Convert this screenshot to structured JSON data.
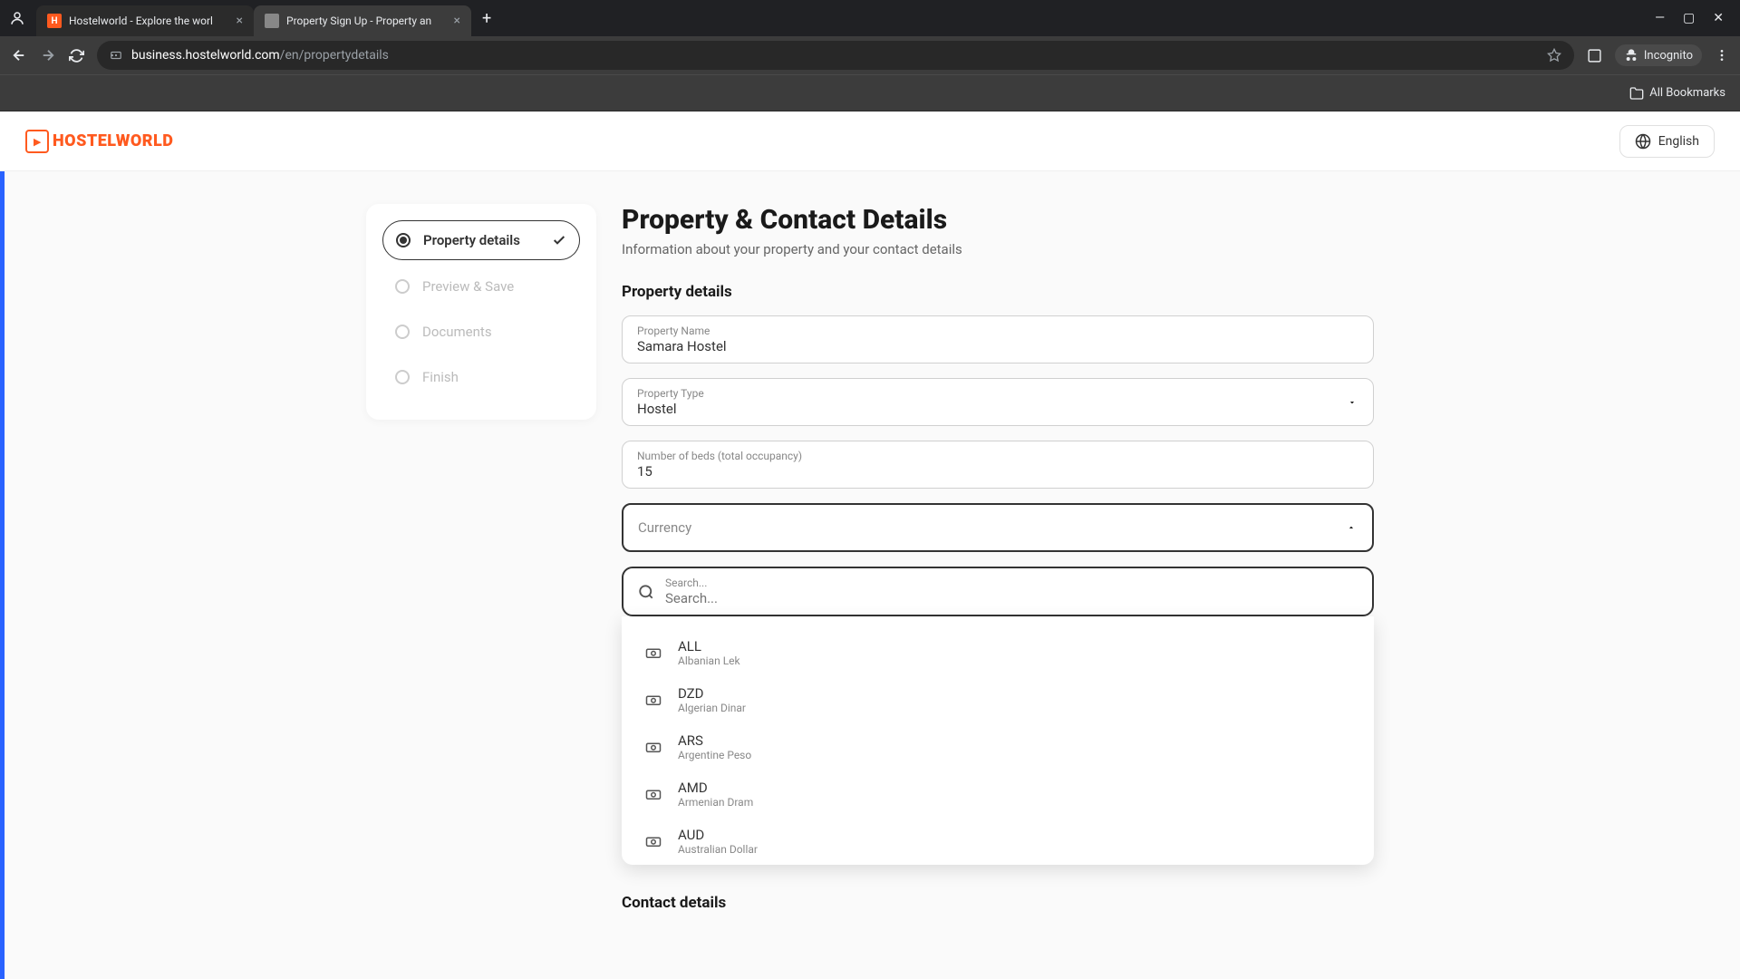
{
  "browser": {
    "tabs": [
      {
        "title": "Hostelworld - Explore the worl",
        "favicon": "H",
        "active": false
      },
      {
        "title": "Property Sign Up - Property an",
        "favicon": "",
        "active": true
      }
    ],
    "url_domain": "business.hostelworld.com",
    "url_path": "/en/propertydetails",
    "incognito_label": "Incognito",
    "bookmarks_label": "All Bookmarks"
  },
  "header": {
    "logo_text": "HOSTELWORLD",
    "language": "English"
  },
  "sidebar": {
    "steps": [
      {
        "label": "Property details",
        "active": true,
        "done": true
      },
      {
        "label": "Preview & Save",
        "active": false,
        "done": false
      },
      {
        "label": "Documents",
        "active": false,
        "done": false
      },
      {
        "label": "Finish",
        "active": false,
        "done": false
      }
    ]
  },
  "main": {
    "title": "Property & Contact Details",
    "subtitle": "Information about your property and your contact details",
    "section_property": "Property details",
    "section_contact": "Contact details",
    "fields": {
      "property_name_label": "Property Name",
      "property_name_value": "Samara Hostel",
      "property_type_label": "Property Type",
      "property_type_value": "Hostel",
      "beds_label": "Number of beds (total occupancy)",
      "beds_value": "15",
      "currency_label": "Currency"
    },
    "search_placeholder": "Search...",
    "currency_options": [
      {
        "code": "ALL",
        "name": "Albanian Lek"
      },
      {
        "code": "DZD",
        "name": "Algerian Dinar"
      },
      {
        "code": "ARS",
        "name": "Argentine Peso"
      },
      {
        "code": "AMD",
        "name": "Armenian Dram"
      },
      {
        "code": "AUD",
        "name": "Australian Dollar"
      }
    ]
  }
}
